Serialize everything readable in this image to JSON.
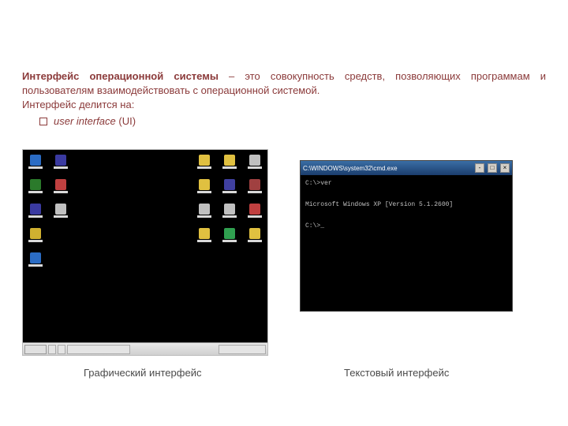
{
  "heading_part_bold": "Интерфейс операционной системы",
  "heading_part_rest": " – это совокупность средств, позволяющих программам и пользователям взаимодействовать с операционной системой.",
  "subhead": "Интерфейс делится на:",
  "bullet_italic": "user interface",
  "bullet_rest": " (UI)",
  "desktop_icons": {
    "left_col1": [
      "#2b6cc4",
      "#2b7a2b",
      "#3a3aa0",
      "#d0b030",
      "#2b6cc4"
    ],
    "left_col2": [
      "#3a3aa0",
      "#c04040",
      "#c0c0c0"
    ],
    "right_col1": [
      "#e0c040",
      "#e0c040",
      "#c0c0c0",
      "#e0c040"
    ],
    "right_col2": [
      "#e0c040",
      "#4040a0",
      "#c0c0c0",
      "#30a050"
    ],
    "right_col3": [
      "#c0c0c0",
      "#a04040",
      "#c04040",
      "#e0c040"
    ]
  },
  "cmd": {
    "title": "C:\\WINDOWS\\system32\\cmd.exe",
    "line1": "C:\\>ver",
    "line2": "Microsoft Windows XP [Version 5.1.2600]",
    "line3": "C:\\>_"
  },
  "caption_left": "Графический интерфейс",
  "caption_right": "Текстовый интерфейс"
}
